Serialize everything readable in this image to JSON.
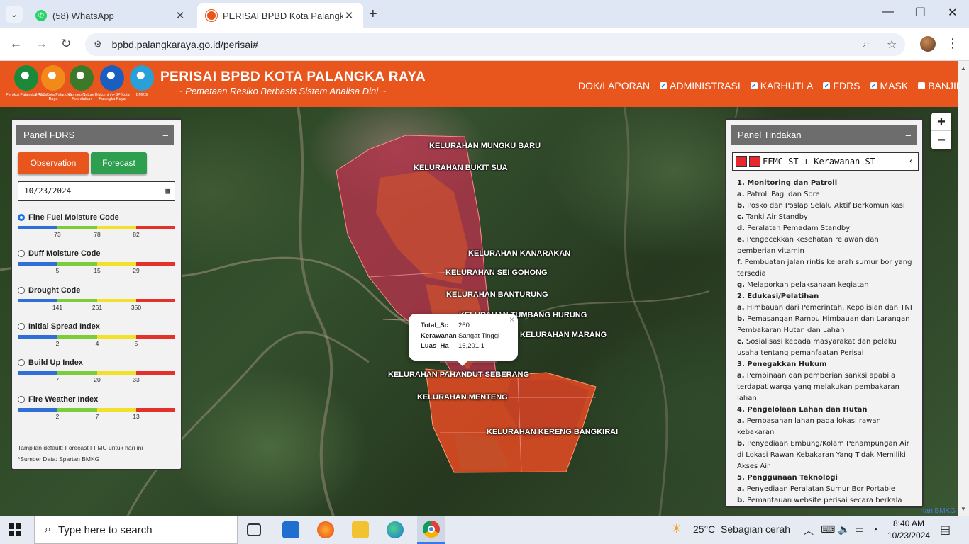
{
  "browser": {
    "tabs": [
      {
        "title": "(58) WhatsApp",
        "icon": "whatsapp-icon"
      },
      {
        "title": "PERISAI BPBD Kota Palangka Ra",
        "icon": "bpbd-icon"
      }
    ],
    "url": "bpbd.palangkaraya.go.id/perisai#"
  },
  "header": {
    "title": "PERISAI BPBD KOTA PALANGKA RAYA",
    "subtitle": "~ Pemetaan Resiko Berbasis Sistem Analisa Dini ~",
    "logos": [
      {
        "caption": "Pemkot Palangka Raya",
        "color": "#1a8a3a"
      },
      {
        "caption": "BPBD Kota Palangka Raya",
        "color": "#f28a1a"
      },
      {
        "caption": "Borneo Nature Foundation",
        "color": "#3c7a2a"
      },
      {
        "caption": "Diskominfo-SP Kota Palangka Raya",
        "color": "#1a5fbf"
      },
      {
        "caption": "BMKG",
        "color": "#2aa0d8"
      }
    ],
    "menu": [
      {
        "label": "DOK/LAPORAN",
        "checkbox": false
      },
      {
        "label": "ADMINISTRASI",
        "checkbox": true,
        "checked": true
      },
      {
        "label": "KARHUTLA",
        "checkbox": true,
        "checked": true
      },
      {
        "label": "FDRS",
        "checkbox": true,
        "checked": true
      },
      {
        "label": "MASK",
        "checkbox": true,
        "checked": true
      },
      {
        "label": "BANJIR",
        "checkbox": true,
        "checked": false
      }
    ]
  },
  "fdrs_panel": {
    "title": "Panel FDRS",
    "minimize": "–",
    "observation_label": "Observation",
    "forecast_label": "Forecast",
    "date": "10/23/2024",
    "indices": [
      {
        "label": "Fine Fuel Moisture Code",
        "selected": true,
        "ticks": [
          "73",
          "78",
          "82"
        ]
      },
      {
        "label": "Duff Moisture Code",
        "selected": false,
        "ticks": [
          "5",
          "15",
          "29"
        ]
      },
      {
        "label": "Drought Code",
        "selected": false,
        "ticks": [
          "141",
          "261",
          "350"
        ]
      },
      {
        "label": "Initial Spread Index",
        "selected": false,
        "ticks": [
          "2",
          "4",
          "5"
        ]
      },
      {
        "label": "Build Up Index",
        "selected": false,
        "ticks": [
          "7",
          "20",
          "33"
        ]
      },
      {
        "label": "Fire Weather Index",
        "selected": false,
        "ticks": [
          "2",
          "7",
          "13"
        ]
      }
    ],
    "scale_colors": [
      "#2f6fd6",
      "#7dcc3a",
      "#f2e12b",
      "#e2322a"
    ],
    "note1": "Tampilan default: Forecast FFMC untuk hari ini",
    "note2": "*Sumber Data: Spartan BMKG"
  },
  "tindakan_panel": {
    "title": "Panel Tindakan",
    "minimize": "–",
    "select_value": "FFMC ST + Kerawanan ST",
    "sections": [
      {
        "heading": "1. Monitoring dan Patroli",
        "items": [
          {
            "key": "a.",
            "text": "Patroli Pagi dan Sore"
          },
          {
            "key": "b.",
            "text": "Posko dan Poslap Selalu Aktif Berkomunikasi"
          },
          {
            "key": "c.",
            "text": "Tanki Air Standby"
          },
          {
            "key": "d.",
            "text": "Peralatan Pemadam Standby"
          },
          {
            "key": "e.",
            "text": "Pengecekkan kesehatan relawan dan pemberian vitamin"
          },
          {
            "key": "f.",
            "text": "Pembuatan jalan rintis ke arah sumur bor yang tersedia"
          },
          {
            "key": "g.",
            "text": "Melaporkan pelaksanaan kegiatan"
          }
        ]
      },
      {
        "heading": "2. Edukasi/Pelatihan",
        "items": [
          {
            "key": "a.",
            "text": "Himbauan dari Pemerintah, Kepolisian dan TNI"
          },
          {
            "key": "b.",
            "text": "Pemasangan Rambu Himbauan dan Larangan Pembakaran Hutan dan Lahan"
          },
          {
            "key": "c.",
            "text": "Sosialisasi kepada masyarakat dan pelaku usaha tentang pemanfaatan Perisai"
          }
        ]
      },
      {
        "heading": "3. Penegakkan Hukum",
        "items": [
          {
            "key": "a.",
            "text": "Pembinaan dan pemberian sanksi apabila terdapat warga yang melakukan pembakaran lahan"
          }
        ]
      },
      {
        "heading": "4. Pengelolaan Lahan dan Hutan",
        "items": [
          {
            "key": "a.",
            "text": "Pembasahan lahan pada lokasi rawan kebakaran"
          },
          {
            "key": "b.",
            "text": "Penyediaan Embung/Kolam Penampungan Air di Lokasi Rawan Kebakaran Yang Tidak Memiliki Akses Air"
          }
        ]
      },
      {
        "heading": "5. Penggunaan Teknologi",
        "items": [
          {
            "key": "a.",
            "text": "Penyediaan Peralatan Sumur Bor Portable"
          },
          {
            "key": "b.",
            "text": "Pemantauan website perisai secara berkala"
          }
        ]
      }
    ]
  },
  "map": {
    "kelurahan": [
      "KELURAHAN MUNGKU BARU",
      "KELURAHAN BUKIT SUA",
      "KELURAHAN KANARAKAN",
      "KELURAHAN SEI GOHONG",
      "KELURAHAN BANTURUNG",
      "KELURAHAN TUMBANG HURUNG",
      "KELURAHAN MARANG",
      "KELURAHAN PAHANDUT SEBERANG",
      "KELURAHAN MENTENG",
      "KELURAHAN KERENG BANGKIRAI"
    ],
    "popup": {
      "rows": [
        {
          "key": "Total_Sc",
          "value": "260"
        },
        {
          "key": "Kerawanan",
          "value": "Sangat Tinggi"
        },
        {
          "key": "Luas_Ha",
          "value": "16,201.1"
        }
      ],
      "close": "×"
    },
    "zoom_in": "+",
    "zoom_out": "−",
    "attribution": "rtan BMKG",
    "colors": {
      "north_zone": "#b2334a",
      "south_zone": "#e04a22"
    }
  },
  "taskbar": {
    "search_placeholder": "Type here to search",
    "weather_temp": "25°C",
    "weather_desc": "Sebagian cerah",
    "time": "8:40 AM",
    "date": "10/23/2024"
  }
}
